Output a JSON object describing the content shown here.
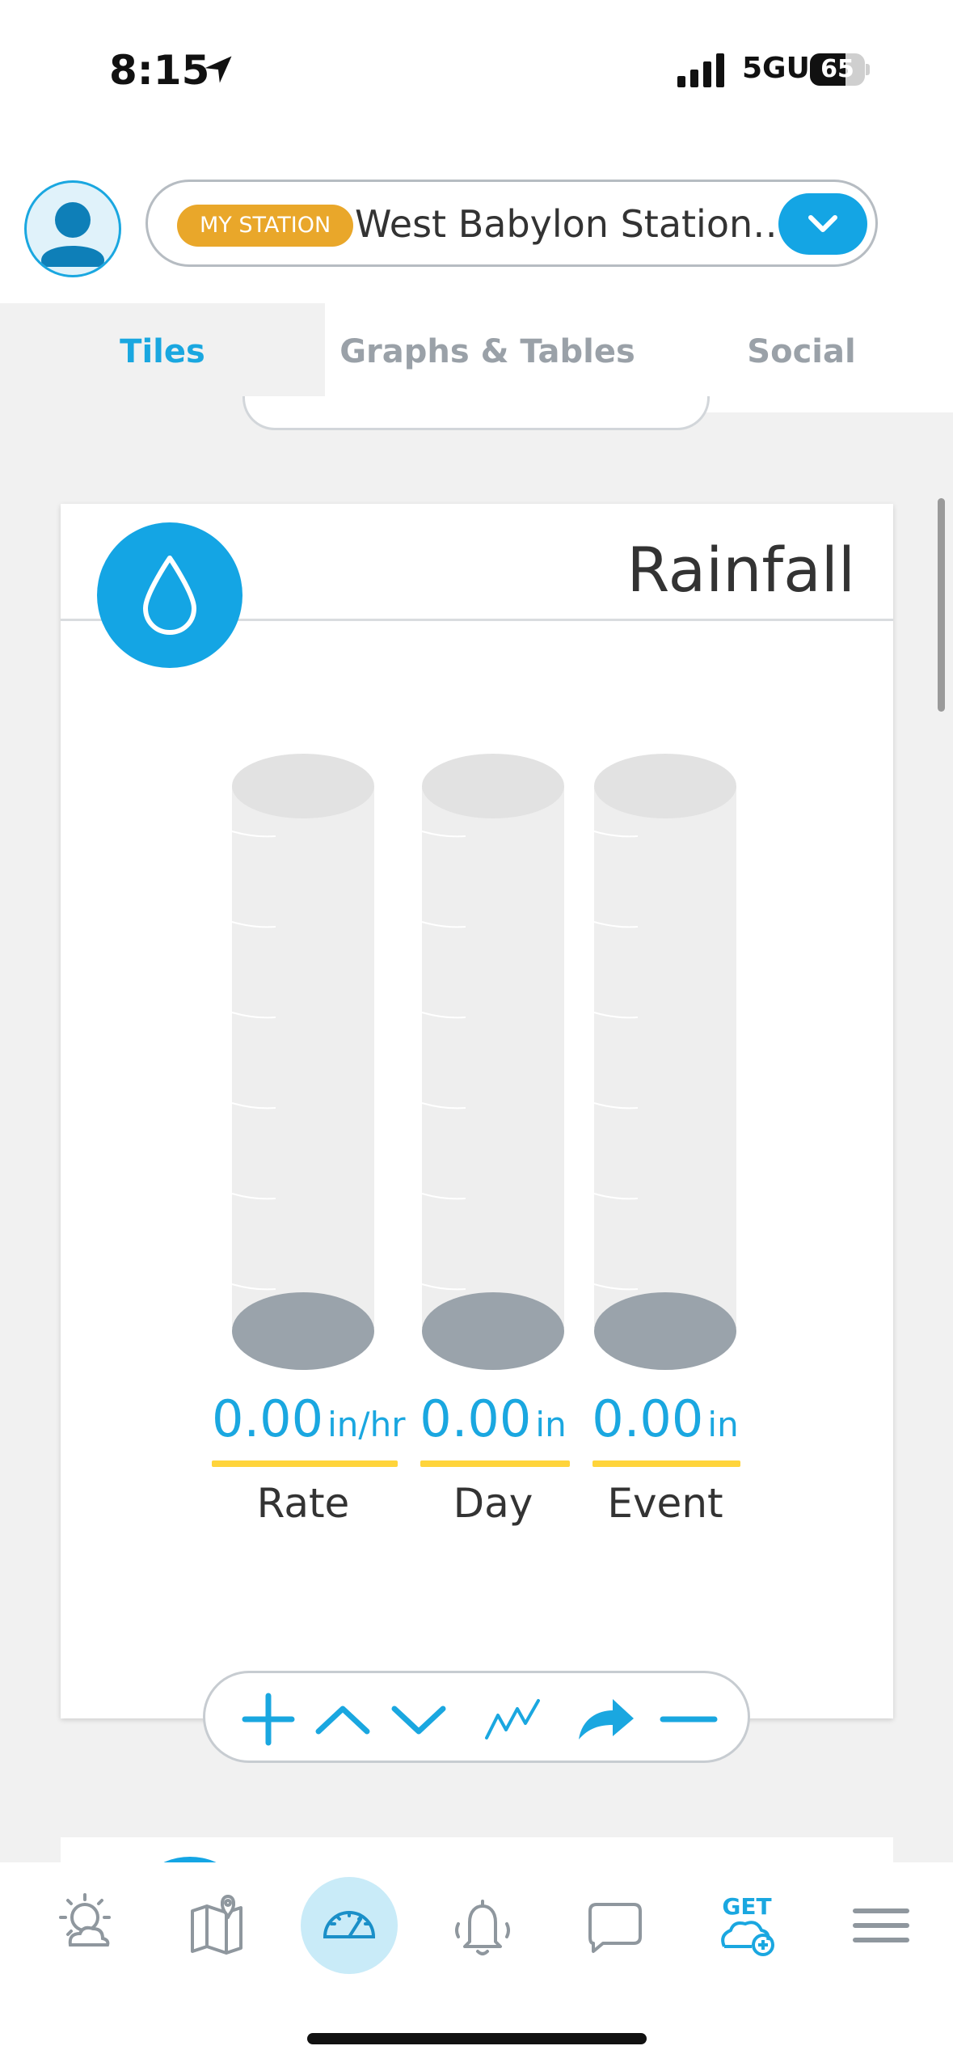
{
  "status_bar": {
    "time": "8:15",
    "network": "5GUC",
    "battery": "65",
    "battery_level": 0.65
  },
  "header": {
    "badge": "MY STATION",
    "station_name": "West Babylon Station, …"
  },
  "tabs": [
    {
      "label": "Tiles",
      "active": true
    },
    {
      "label": "Graphs & Tables",
      "active": false
    },
    {
      "label": "Social",
      "active": false
    }
  ],
  "tile": {
    "title": "Rainfall",
    "icon": "water-drop-icon",
    "gauges": [
      {
        "value": "0.00",
        "unit": "in/hr",
        "label": "Rate",
        "fill": 0
      },
      {
        "value": "0.00",
        "unit": "in",
        "label": "Day",
        "fill": 0
      },
      {
        "value": "0.00",
        "unit": "in",
        "label": "Event",
        "fill": 0
      }
    ]
  },
  "toolbar": {
    "icons": [
      "plus-icon",
      "chevron-up-icon",
      "chevron-down-icon",
      "sparkline-icon",
      "share-arrow-icon",
      "minus-icon"
    ]
  },
  "bottom_nav": {
    "items": [
      "weather-icon",
      "map-icon",
      "dashboard-icon",
      "alerts-bell-icon",
      "chat-icon",
      "get-station-icon",
      "menu-icon"
    ],
    "active": "dashboard-icon",
    "get_label": "GET"
  },
  "colors": {
    "accent": "#1aa7e0",
    "badge": "#e9a72a",
    "underline": "#ffd43b"
  }
}
